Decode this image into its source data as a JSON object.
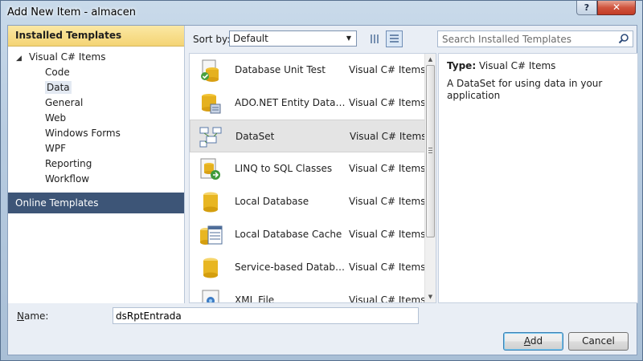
{
  "window": {
    "title": "Add New Item - almacen",
    "help_label": "?",
    "close_label": "✕"
  },
  "left": {
    "installed_header": "Installed Templates",
    "tree_root": "Visual C# Items",
    "tree_items": [
      "Code",
      "Data",
      "General",
      "Web",
      "Windows Forms",
      "WPF",
      "Reporting",
      "Workflow"
    ],
    "selected_item": "Data",
    "online_header": "Online Templates"
  },
  "toolbar": {
    "sort_label": "Sort by:",
    "sort_value": "Default",
    "search_placeholder": "Search Installed Templates"
  },
  "templates": [
    {
      "name": "Database Unit Test",
      "category": "Visual C# Items",
      "icon": "database-unit-test-icon"
    },
    {
      "name": "ADO.NET Entity Data Mo...",
      "category": "Visual C# Items",
      "icon": "entity-data-model-icon"
    },
    {
      "name": "DataSet",
      "category": "Visual C# Items",
      "icon": "dataset-icon",
      "selected": true
    },
    {
      "name": "LINQ to SQL Classes",
      "category": "Visual C# Items",
      "icon": "linq-to-sql-icon"
    },
    {
      "name": "Local Database",
      "category": "Visual C# Items",
      "icon": "local-database-icon"
    },
    {
      "name": "Local Database Cache",
      "category": "Visual C# Items",
      "icon": "local-database-cache-icon"
    },
    {
      "name": "Service-based Database",
      "category": "Visual C# Items",
      "icon": "service-based-database-icon"
    },
    {
      "name": "XML File",
      "category": "Visual C# Items",
      "icon": "xml-file-icon"
    }
  ],
  "details": {
    "type_label": "Type:",
    "type_value": "Visual C# Items",
    "description": "A DataSet for using data in your application"
  },
  "bottom": {
    "name_label_prefix": "",
    "name_label_accel": "N",
    "name_label_rest": "ame:",
    "name_value": "dsRptEntrada",
    "add_accel": "A",
    "add_rest": "dd",
    "cancel_label": "Cancel"
  },
  "colors": {
    "accent": "#3d5577",
    "header_yellow": "#f4d474",
    "selection_gray": "#e4e4e4"
  }
}
